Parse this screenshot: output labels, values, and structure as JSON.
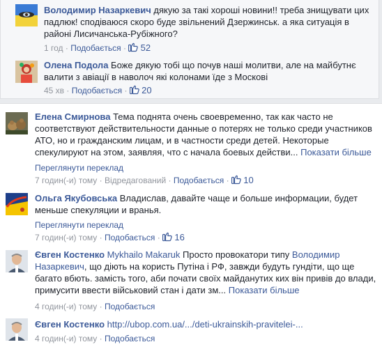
{
  "replies": [
    {
      "author": "Володимир Назаркевич",
      "text": "дякую за такі хороші новини!! треба знищувати цих падлюк! сподіваюся скоро буде звільнений Дзержинськ. а яка ситуація в районі Лисичанська-Рубіжного?",
      "time": "1 год",
      "like_label": "Подобається",
      "likes": "52"
    },
    {
      "author": "Олена Подола",
      "text": "Боже дякую тобі що почув наші молитви, але на майбутнє валити з авіації в наволоч які колонами їде з Москові",
      "time": "45 хв",
      "like_label": "Подобається",
      "likes": "20"
    }
  ],
  "comments": [
    {
      "author": "Елена Смирнова",
      "text": "Тема поднята очень своевременно, так как часто не соответствуют действительности данные о потерях не только среди участников АТО, но и гражданским лицам, и в частности среди детей. Некоторые спекулируют на этом, заявляя, что с начала боевых действи...",
      "more": "Показати більше",
      "translate": "Переглянути переклад",
      "time": "7 годин(-и) тому",
      "status": "Відредагований",
      "like_label": "Подобається",
      "likes": "10"
    },
    {
      "author": "Ольга Якубовська",
      "text": "Владислав, давайте чаще и больше информации, будет меньше спекуляции и вранья.",
      "translate": "Переглянути переклад",
      "time": "7 годин(-и) тому",
      "like_label": "Подобається",
      "likes": "16"
    },
    {
      "author": "Євген Костенко",
      "mention": "Mykhailo Makaruk",
      "text_a": "Просто провокатори типу",
      "mention2": "Володимир Назаркевич",
      "text_b": ", що діють на користь Путіна і РФ, завжди будуть гундіти, що ще багато вбють. замість того, аби почати своїх майданутих ких він привів до влади, примусити ввести військовий стан і дати зм...",
      "more": "Показати більше",
      "time": "4 годин(-и) тому",
      "like_label": "Подобається"
    },
    {
      "author": "Євген Костенко",
      "link": "http://ubop.com.ua/.../deti-ukrainskih-pravitelei-...",
      "time": "4 годин(-и) тому",
      "like_label": "Подобається"
    }
  ],
  "separator": "·",
  "colors": {
    "link": "#3b5998",
    "meta": "#90949c",
    "reply_bg": "#f6f7f9"
  },
  "icons": {
    "like": "thumbs-up-icon"
  }
}
